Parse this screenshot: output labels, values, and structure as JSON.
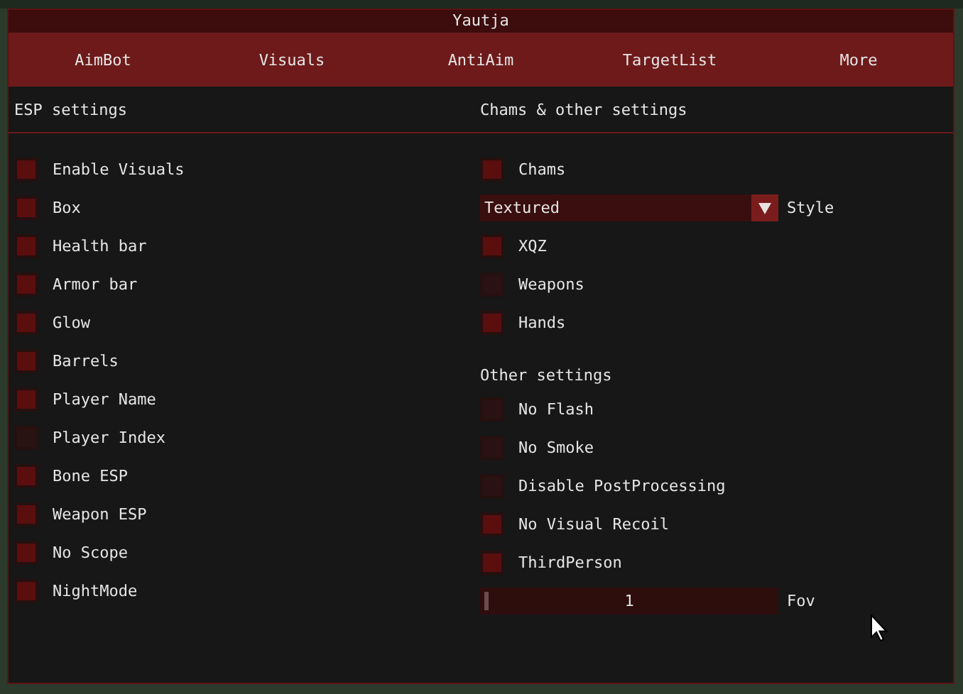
{
  "window": {
    "title": "Yautja"
  },
  "tabs": [
    {
      "label": "AimBot"
    },
    {
      "label": "Visuals"
    },
    {
      "label": "AntiAim"
    },
    {
      "label": "TargetList"
    },
    {
      "label": "More"
    }
  ],
  "esp_settings": {
    "heading": "ESP settings",
    "options": [
      {
        "label": "Enable Visuals",
        "checked": true
      },
      {
        "label": "Box",
        "checked": true
      },
      {
        "label": "Health bar",
        "checked": true
      },
      {
        "label": "Armor bar",
        "checked": true
      },
      {
        "label": "Glow",
        "checked": true
      },
      {
        "label": "Barrels",
        "checked": true
      },
      {
        "label": "Player Name",
        "checked": true
      },
      {
        "label": "Player Index",
        "checked": false
      },
      {
        "label": "Bone ESP",
        "checked": true
      },
      {
        "label": "Weapon ESP",
        "checked": true
      },
      {
        "label": "No Scope",
        "checked": true
      },
      {
        "label": "NightMode",
        "checked": true
      }
    ]
  },
  "chams_settings": {
    "heading": "Chams & other settings",
    "items": [
      {
        "kind": "checkbox",
        "label": "Chams",
        "checked": true
      },
      {
        "kind": "dropdown",
        "label": "Style",
        "selected_option": "Textured"
      },
      {
        "kind": "checkbox",
        "label": "XQZ",
        "checked": true
      },
      {
        "kind": "checkbox",
        "label": "Weapons",
        "checked": false
      },
      {
        "kind": "checkbox",
        "label": "Hands",
        "checked": true
      }
    ]
  },
  "other_settings": {
    "heading": "Other settings",
    "items": [
      {
        "kind": "checkbox",
        "label": "No Flash",
        "checked": false
      },
      {
        "kind": "checkbox",
        "label": "No Smoke",
        "checked": false
      },
      {
        "kind": "checkbox",
        "label": "Disable PostProcessing",
        "checked": false
      },
      {
        "kind": "checkbox",
        "label": "No Visual Recoil",
        "checked": true
      },
      {
        "kind": "checkbox",
        "label": "ThirdPerson",
        "checked": true
      },
      {
        "kind": "slider",
        "reading": "1",
        "label": "Fov",
        "level": 0
      }
    ]
  }
}
